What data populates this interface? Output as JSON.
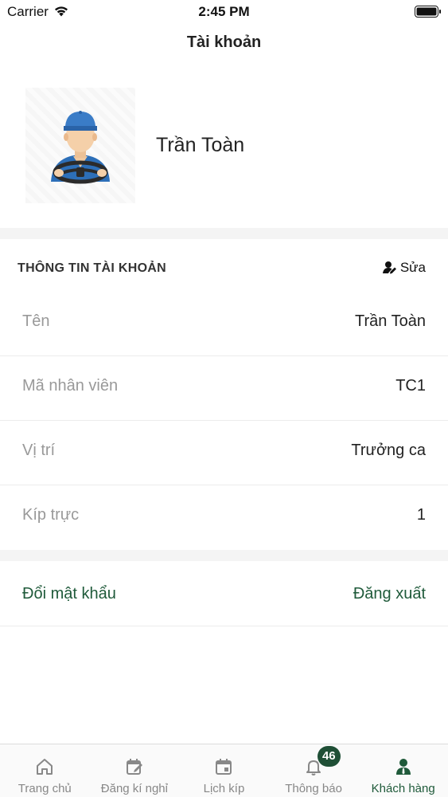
{
  "status_bar": {
    "carrier": "Carrier",
    "time": "2:45 PM"
  },
  "nav": {
    "title": "Tài khoản"
  },
  "profile": {
    "name": "Trần Toàn"
  },
  "section": {
    "title": "THÔNG TIN TÀI KHOẢN",
    "edit_label": "Sửa"
  },
  "info_rows": [
    {
      "label": "Tên",
      "value": "Trần Toàn"
    },
    {
      "label": "Mã nhân viên",
      "value": "TC1"
    },
    {
      "label": "Vị trí",
      "value": "Trưởng ca"
    },
    {
      "label": "Kíp trực",
      "value": "1"
    }
  ],
  "actions": {
    "change_password": "Đổi mật khẩu",
    "logout": "Đăng xuất"
  },
  "tabs": [
    {
      "label": "Trang chủ",
      "icon": "home-icon"
    },
    {
      "label": "Đăng kí nghỉ",
      "icon": "calendar-edit-icon"
    },
    {
      "label": "Lịch kíp",
      "icon": "calendar-icon"
    },
    {
      "label": "Thông báo",
      "icon": "bell-icon",
      "badge": "46"
    },
    {
      "label": "Khách hàng",
      "icon": "person-icon",
      "active": true
    }
  ],
  "colors": {
    "accent": "#1f5a3a",
    "badge": "#1f4f36",
    "muted": "#999999"
  }
}
